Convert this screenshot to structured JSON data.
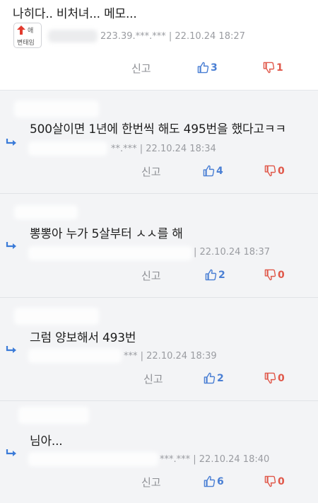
{
  "main_comment": {
    "text": "나히다.. 비처녀... 메모...",
    "badge": {
      "line1": "애",
      "line2": "변태임"
    },
    "meta": "223.39.***.*** | 22.10.24 18:27",
    "report_label": "신고",
    "upvotes": "3",
    "downvotes": "1"
  },
  "replies": [
    {
      "text": "500살이면 1년에 한번씩 해도 495번을 했다고ㅋㅋ",
      "meta": "**.*** | 22.10.24 18:34",
      "report_label": "신고",
      "upvotes": "4",
      "downvotes": "0"
    },
    {
      "text": "뽕뽕아 누가 5살부터 ㅅㅅ를 해",
      "meta": "| 22.10.24 18:37",
      "report_label": "신고",
      "upvotes": "2",
      "downvotes": "0"
    },
    {
      "text": "그럼 양보해서 493번",
      "meta": "*** | 22.10.24 18:39",
      "report_label": "신고",
      "upvotes": "2",
      "downvotes": "0"
    },
    {
      "text": "님아...",
      "meta": "***.*** | 22.10.24 18:40",
      "report_label": "신고",
      "upvotes": "6",
      "downvotes": "0"
    }
  ],
  "icons": {
    "up": "thumbs-up-icon",
    "down": "thumbs-down-icon",
    "reply": "reply-arrow-icon",
    "badge_arrow": "red-up-arrow-icon"
  },
  "colors": {
    "upvote": "#4a7fd4",
    "downvote": "#e0584a",
    "reply_bg": "#f3f4f6",
    "reply_arrow": "#3b7bd8",
    "badge_arrow": "#e23b2e"
  }
}
